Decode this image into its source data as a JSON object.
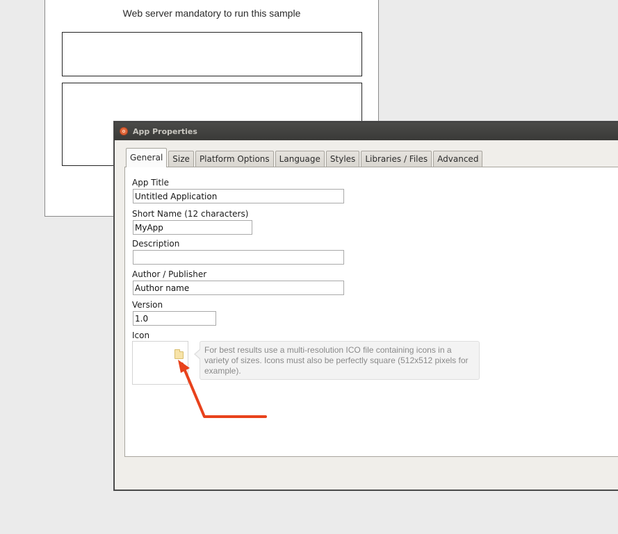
{
  "background_page": {
    "heading": "Web server mandatory to run this sample"
  },
  "dialog": {
    "title": "App Properties",
    "tabs": [
      {
        "label": "General",
        "active": true
      },
      {
        "label": "Size"
      },
      {
        "label": "Platform Options"
      },
      {
        "label": "Language"
      },
      {
        "label": "Styles"
      },
      {
        "label": "Libraries / Files"
      },
      {
        "label": "Advanced"
      }
    ],
    "fields": {
      "app_title": {
        "label": "App Title",
        "value": "Untitled Application"
      },
      "short_name": {
        "label": "Short Name (12 characters)",
        "value": "MyApp"
      },
      "description": {
        "label": "Description",
        "value": ""
      },
      "author": {
        "label": "Author / Publisher",
        "value": "Author name"
      },
      "version": {
        "label": "Version",
        "value": "1.0"
      },
      "icon": {
        "label": "Icon",
        "hint": "For best results use a multi-resolution ICO file containing icons in a variety of sizes. Icons must also be perfectly square (512x512 pixels for example)."
      }
    }
  },
  "colors": {
    "annotation_arrow": "#e8421c",
    "titlebar": "#3f3f3d",
    "title_icon": "#e0663a"
  },
  "icons": {
    "title_icon": "app-logo-icon",
    "folder_icon": "folder-icon"
  }
}
